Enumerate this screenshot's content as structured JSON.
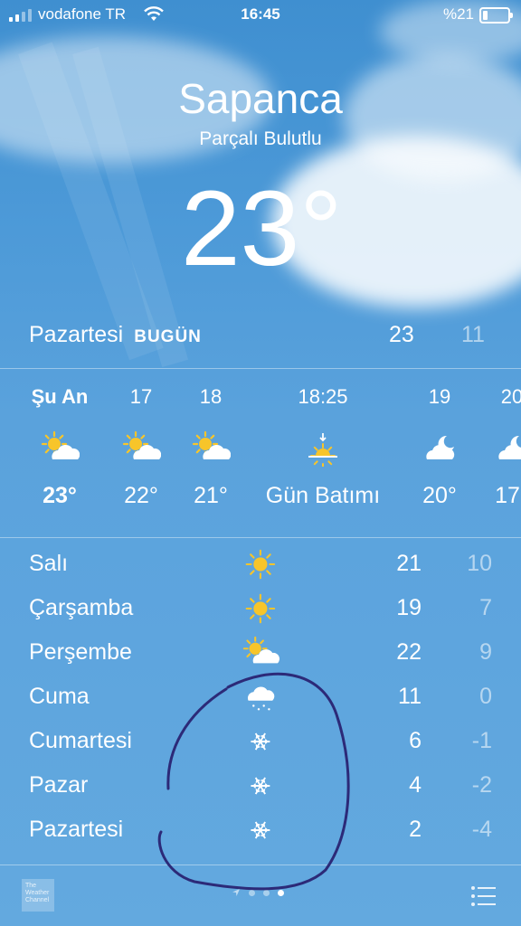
{
  "status_bar": {
    "carrier": "vodafone TR",
    "time": "16:45",
    "battery": "%21"
  },
  "header": {
    "city": "Sapanca",
    "condition": "Parçalı Bulutlu",
    "temperature": "23°"
  },
  "today": {
    "day": "Pazartesi",
    "tag": "BUGÜN",
    "high": "23",
    "low": "11"
  },
  "hourly": [
    {
      "label": "Şu An",
      "icon": "partly-cloudy-icon",
      "value": "23°"
    },
    {
      "label": "17",
      "icon": "partly-cloudy-icon",
      "value": "22°"
    },
    {
      "label": "18",
      "icon": "partly-cloudy-icon",
      "value": "21°"
    },
    {
      "label": "18:25",
      "icon": "sunset-icon",
      "value": "Gün Batımı"
    },
    {
      "label": "19",
      "icon": "partly-cloudy-night-icon",
      "value": "20°"
    },
    {
      "label": "20",
      "icon": "partly-cloudy-night-icon",
      "value": "17°"
    }
  ],
  "daily": [
    {
      "day": "Salı",
      "icon": "sun-icon",
      "high": "21",
      "low": "10"
    },
    {
      "day": "Çarşamba",
      "icon": "sun-icon",
      "high": "19",
      "low": "7"
    },
    {
      "day": "Perşembe",
      "icon": "partly-cloudy-icon",
      "high": "22",
      "low": "9"
    },
    {
      "day": "Cuma",
      "icon": "sleet-icon",
      "high": "11",
      "low": "0"
    },
    {
      "day": "Cumartesi",
      "icon": "snowflake-icon",
      "high": "6",
      "low": "-1"
    },
    {
      "day": "Pazar",
      "icon": "snowflake-icon",
      "high": "4",
      "low": "-2"
    },
    {
      "day": "Pazartesi",
      "icon": "snowflake-icon",
      "high": "2",
      "low": "-4"
    }
  ],
  "footer": {
    "logo_text": "The Weather Channel"
  },
  "colors": {
    "sun": "#f7c52a",
    "sky": "#4d9ad8"
  }
}
